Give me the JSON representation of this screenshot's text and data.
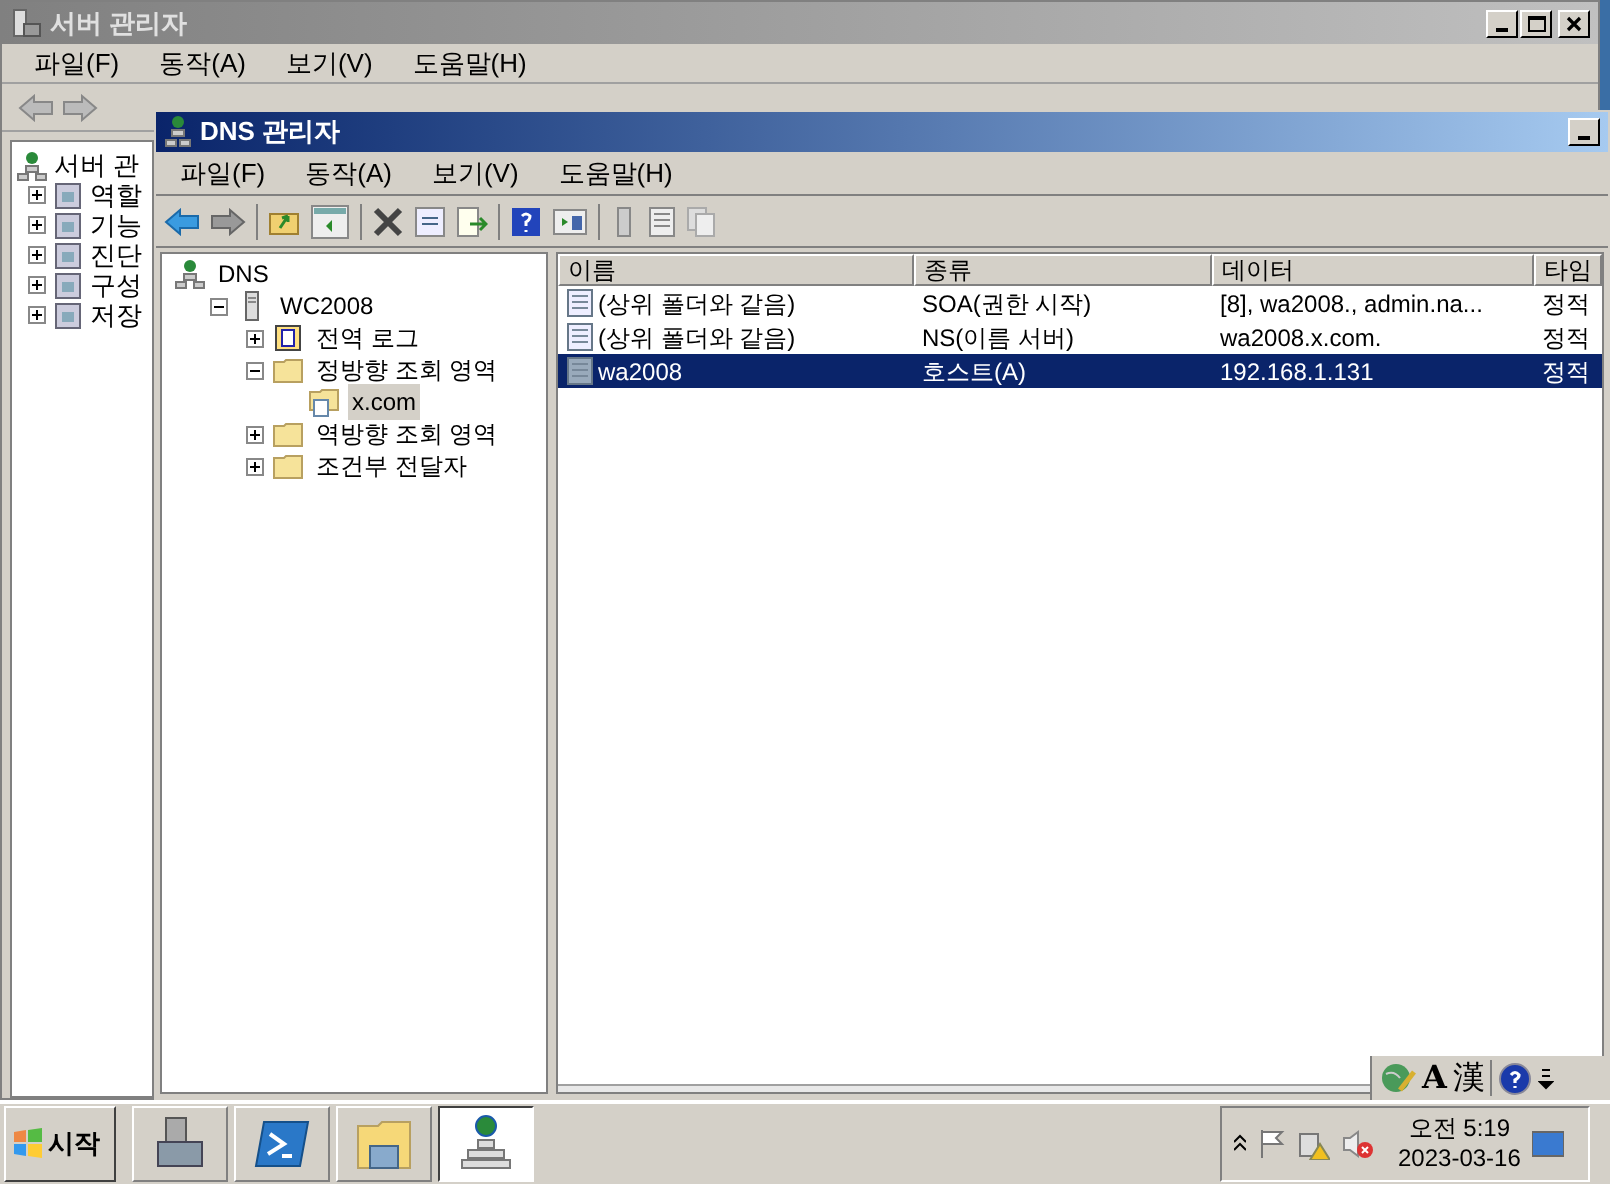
{
  "back_window": {
    "title": "서버 관리자",
    "menu": [
      "파일(F)",
      "동작(A)",
      "보기(V)",
      "도움말(H)"
    ],
    "tree": [
      {
        "label": "서버 관",
        "kind": "root"
      },
      {
        "label": "역할",
        "kind": "item",
        "expanded": false
      },
      {
        "label": "기능",
        "kind": "item",
        "expanded": false
      },
      {
        "label": "진단",
        "kind": "item",
        "expanded": false
      },
      {
        "label": "구성",
        "kind": "item",
        "expanded": false
      },
      {
        "label": "저장",
        "kind": "item",
        "expanded": false
      }
    ]
  },
  "dns_window": {
    "title": "DNS 관리자",
    "menu": [
      "파일(F)",
      "동작(A)",
      "보기(V)",
      "도움말(H)"
    ],
    "tree": [
      {
        "label": "DNS",
        "kind": "root",
        "selected": false,
        "children": [
          {
            "label": "WC2008",
            "kind": "server",
            "selected": false,
            "expanded": true,
            "children": [
              {
                "label": "전역 로그",
                "kind": "log",
                "selected": false,
                "expanded": false
              },
              {
                "label": "정방향 조회 영역",
                "kind": "folder",
                "selected": false,
                "expanded": true,
                "children": [
                  {
                    "label": "x.com",
                    "kind": "zone",
                    "selected": true
                  }
                ]
              },
              {
                "label": "역방향 조회 영역",
                "kind": "folder",
                "selected": false,
                "expanded": false
              },
              {
                "label": "조건부 전달자",
                "kind": "folder",
                "selected": false,
                "expanded": false
              }
            ]
          }
        ]
      }
    ],
    "table": {
      "columns": [
        "이름",
        "종류",
        "데이터",
        "타임"
      ],
      "rows": [
        {
          "cells": [
            "(상위 폴더와 같음)",
            "SOA(권한 시작)",
            "[8], wa2008., admin.na...",
            "정적"
          ],
          "selected": false
        },
        {
          "cells": [
            "(상위 폴더와 같음)",
            "NS(이름 서버)",
            "wa2008.x.com.",
            "정적"
          ],
          "selected": false
        },
        {
          "cells": [
            "wa2008",
            "호스트(A)",
            "192.168.1.131",
            "정적"
          ],
          "selected": true
        }
      ]
    }
  },
  "language_bar": [
    "A",
    "漢"
  ],
  "taskbar": {
    "start": "시작",
    "buttons": [
      {
        "kind": "server",
        "selected": false
      },
      {
        "kind": "shell",
        "selected": false
      },
      {
        "kind": "explorer",
        "selected": false
      },
      {
        "kind": "dns",
        "selected": true
      }
    ],
    "time": "오전 5:19",
    "date": "2023-03-16"
  }
}
